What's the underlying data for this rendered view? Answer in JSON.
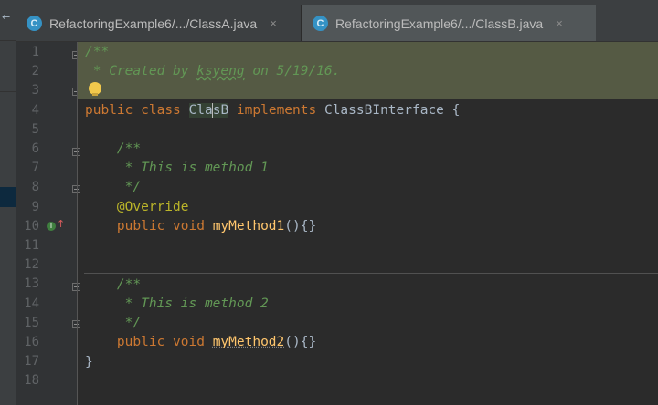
{
  "tabs": [
    {
      "icon": "C",
      "label": "RefactoringExample6/.../ClassA.java",
      "close": "×",
      "active": false
    },
    {
      "icon": "C",
      "label": "RefactoringExample6/.../ClassB.java",
      "close": "×",
      "active": true
    }
  ],
  "left_strip": {
    "arrow": "←"
  },
  "gutter": {
    "line_numbers": [
      "1",
      "2",
      "3",
      "4",
      "5",
      "6",
      "7",
      "8",
      "9",
      "10",
      "11",
      "12",
      "13",
      "14",
      "15",
      "16",
      "17",
      "18"
    ],
    "override_marker": "I",
    "override_arrow": "↑"
  },
  "code": {
    "l1": "/**",
    "l2_prefix": " * Created by ",
    "l2_author": "ksyeng",
    "l2_suffix": " on 5/19/16.",
    "l4_public": "public",
    "l4_class": "class",
    "l4_name_a": "Cla",
    "l4_name_b": "sB",
    "l4_implements": "implements",
    "l4_iface": "ClassBInterface {",
    "l6": "    /**",
    "l7": "     * This is method 1",
    "l8": "     */",
    "l9": "    @Override",
    "l10_public": "    public",
    "l10_void": "void",
    "l10_name": "myMethod1",
    "l10_rest": "(){}",
    "l13": "    /**",
    "l14": "     * This is method 2",
    "l15": "     */",
    "l16_public": "    public",
    "l16_void": "void",
    "l16_name": "myMethod2",
    "l16_rest": "(){}",
    "l17": "}"
  },
  "colors": {
    "editor_bg": "#2b2b2b",
    "keyword": "#cc7832",
    "doc_comment": "#629755",
    "annotation": "#bbb529",
    "method_decl": "#ffc66d",
    "plain": "#a9b7c6"
  }
}
